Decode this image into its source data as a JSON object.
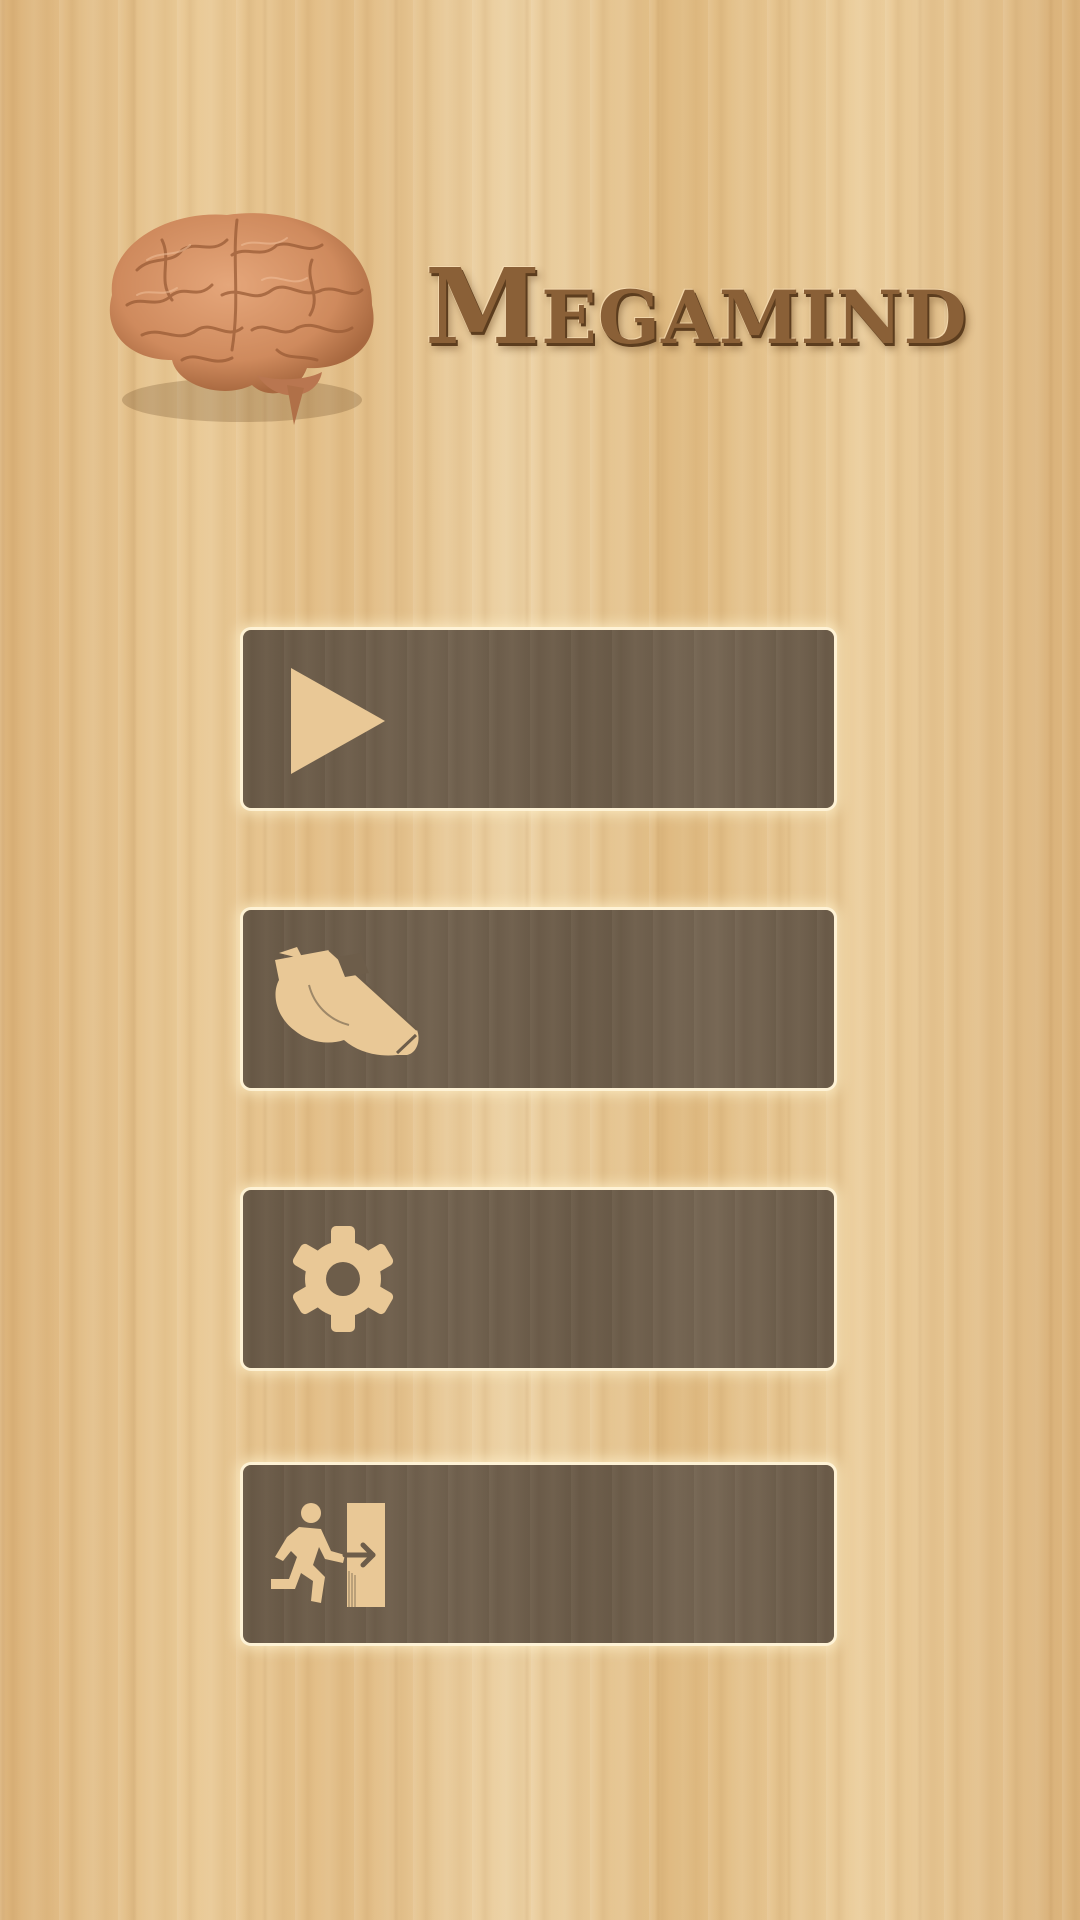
{
  "app": {
    "title": "Megamind"
  },
  "menu": {
    "buttons": [
      {
        "id": "play",
        "icon": "play-icon"
      },
      {
        "id": "whistle",
        "icon": "whistle-icon"
      },
      {
        "id": "settings",
        "icon": "gear-icon"
      },
      {
        "id": "exit",
        "icon": "exit-running-icon"
      }
    ]
  },
  "colors": {
    "background_wood": "#e6c38f",
    "title": "#8a6037",
    "button_fill": "#6d5d4a",
    "button_glow": "#fff1c8",
    "icon": "#e9c896"
  }
}
